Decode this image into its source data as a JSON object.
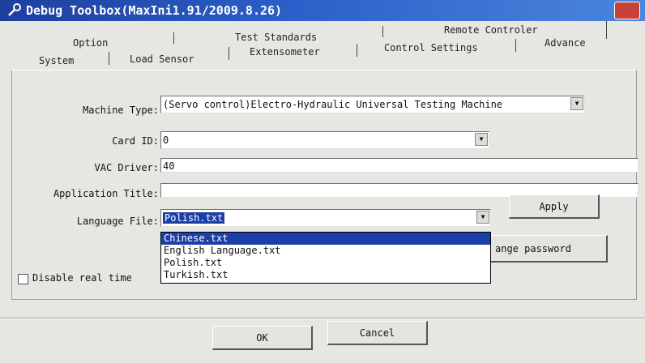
{
  "window": {
    "title": "Debug Toolbox(MaxIni1.91/2009.8.26)"
  },
  "tabs": {
    "row_back": [
      "Option",
      "Test Standards",
      "Remote Controler"
    ],
    "row_mid": [
      "Extensometer",
      "Control Settings",
      "Advance"
    ],
    "row_front": [
      "System",
      "Load Sensor"
    ]
  },
  "form": {
    "machine_type": {
      "label": "Machine Type:",
      "value": "(Servo control)Electro-Hydraulic Universal Testing Machine"
    },
    "card_id": {
      "label": "Card ID:",
      "value": "0"
    },
    "vac_driver": {
      "label": "VAC Driver:",
      "value": "40"
    },
    "app_title": {
      "label": "Application Title:",
      "value": ""
    },
    "language_file": {
      "label": "Language File:",
      "value": "Polish.txt",
      "options": [
        "Chinese.txt",
        "English Language.txt",
        "Polish.txt",
        "Turkish.txt"
      ]
    },
    "apply_label": "Apply",
    "change_password_label": "ange password",
    "disable_realtime_label": "Disable real time"
  },
  "footer": {
    "ok_label": "OK",
    "cancel_label": "Cancel"
  },
  "colors": {
    "title_bar": "#1d3f9e",
    "selection": "#1c3ea8",
    "window_bg": "#e6e7e3"
  }
}
